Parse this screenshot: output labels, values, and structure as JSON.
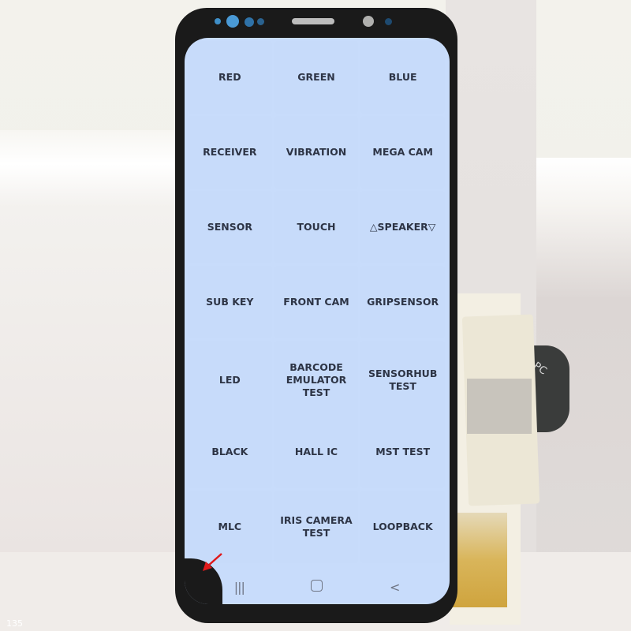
{
  "scene": {
    "description": "Samsung phone display assembly showing hardware test menu",
    "watermark": "135",
    "ribbon_label": "PC"
  },
  "test_menu": {
    "items": [
      {
        "label": "RED"
      },
      {
        "label": "GREEN"
      },
      {
        "label": "BLUE"
      },
      {
        "label": "RECEIVER"
      },
      {
        "label": "VIBRATION"
      },
      {
        "label": "MEGA CAM"
      },
      {
        "label": "SENSOR"
      },
      {
        "label": "TOUCH"
      },
      {
        "label": "△SPEAKER▽"
      },
      {
        "label": "SUB KEY"
      },
      {
        "label": "FRONT CAM"
      },
      {
        "label": "GRIPSENSOR"
      },
      {
        "label": "LED"
      },
      {
        "label": "BARCODE EMULATOR TEST"
      },
      {
        "label": "SENSORHUB TEST"
      },
      {
        "label": "BLACK"
      },
      {
        "label": "HALL IC"
      },
      {
        "label": "MST TEST"
      },
      {
        "label": "MLC"
      },
      {
        "label": "IRIS CAMERA TEST"
      },
      {
        "label": "LOOPBACK"
      }
    ]
  },
  "navbar": {
    "recents": "|||",
    "home": "home",
    "back": "<"
  },
  "colors": {
    "screen_bg": "#c8dcfb",
    "label_text": "#2d3445",
    "bezel": "#1a1a1a",
    "annotation_arrow": "#e0191b"
  }
}
